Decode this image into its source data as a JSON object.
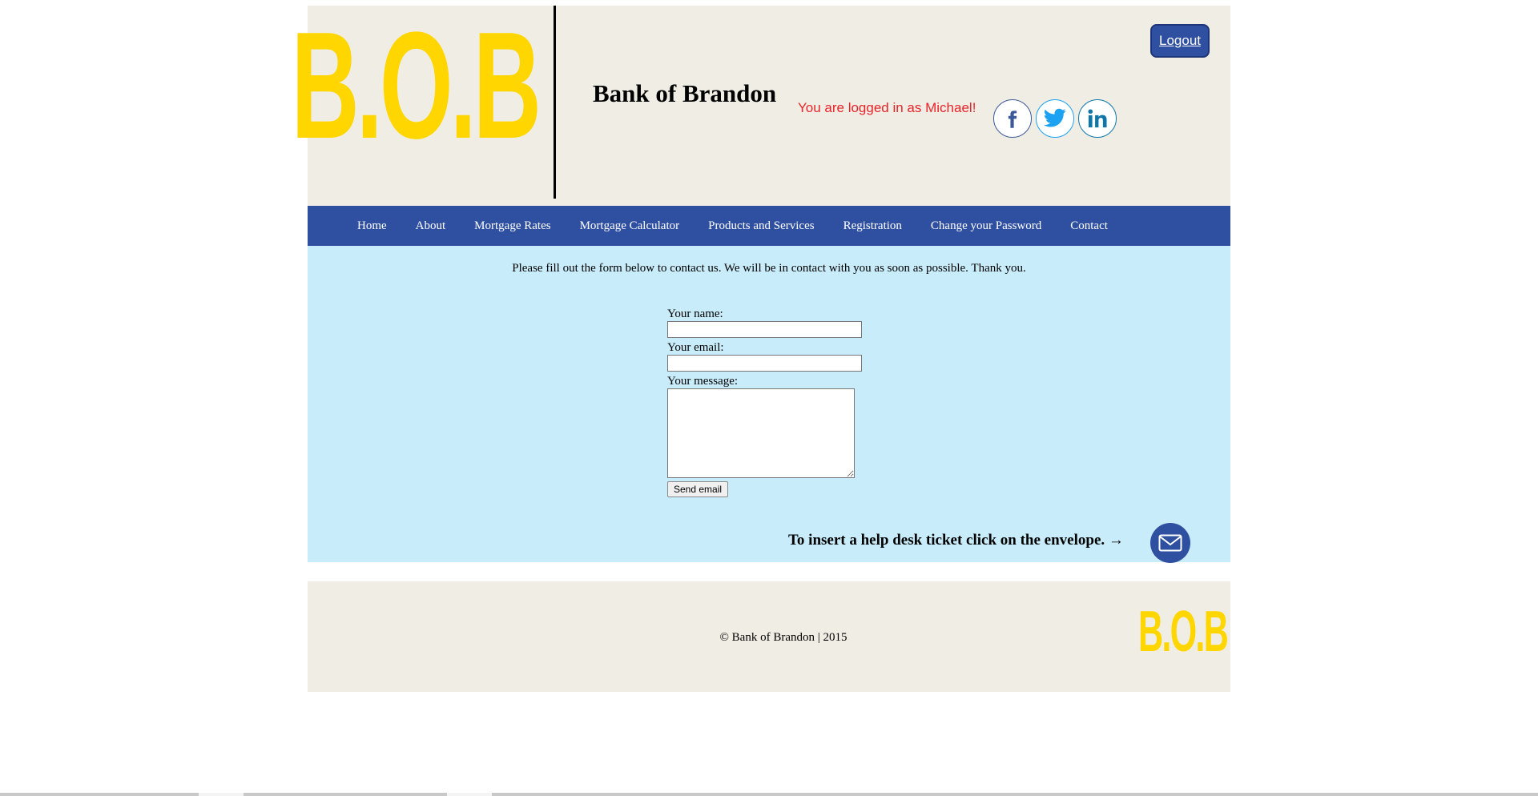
{
  "header": {
    "logo_text": "B.O.B",
    "bank_title": "Bank of Brandon",
    "login_status": "You are logged in as Michael!",
    "logout_label": "Logout",
    "social": [
      "facebook-icon",
      "twitter-icon",
      "linkedin-icon"
    ]
  },
  "nav": {
    "items": [
      {
        "label": "Home"
      },
      {
        "label": "About"
      },
      {
        "label": "Mortgage Rates"
      },
      {
        "label": "Mortgage Calculator"
      },
      {
        "label": "Products and Services"
      },
      {
        "label": "Registration"
      },
      {
        "label": "Change your Password"
      },
      {
        "label": "Contact"
      }
    ]
  },
  "main": {
    "intro": "Please fill out the form below to contact us. We will be in contact with you as soon as possible. Thank you.",
    "form": {
      "name_label": "Your name:",
      "name_value": "",
      "email_label": "Your email:",
      "email_value": "",
      "message_label": "Your message:",
      "message_value": "",
      "send_label": "Send email"
    },
    "help_desk_text": "To insert a help desk ticket click on the envelope. →"
  },
  "footer": {
    "copyright": "© Bank of Brandon | 2015",
    "logo_text": "B.O.B"
  },
  "colors": {
    "logo_yellow": "#ffd600",
    "nav_blue": "#2f50a1",
    "header_bg": "#f0ede4",
    "main_bg": "#c8ecfa",
    "status_red": "#e8242b"
  }
}
